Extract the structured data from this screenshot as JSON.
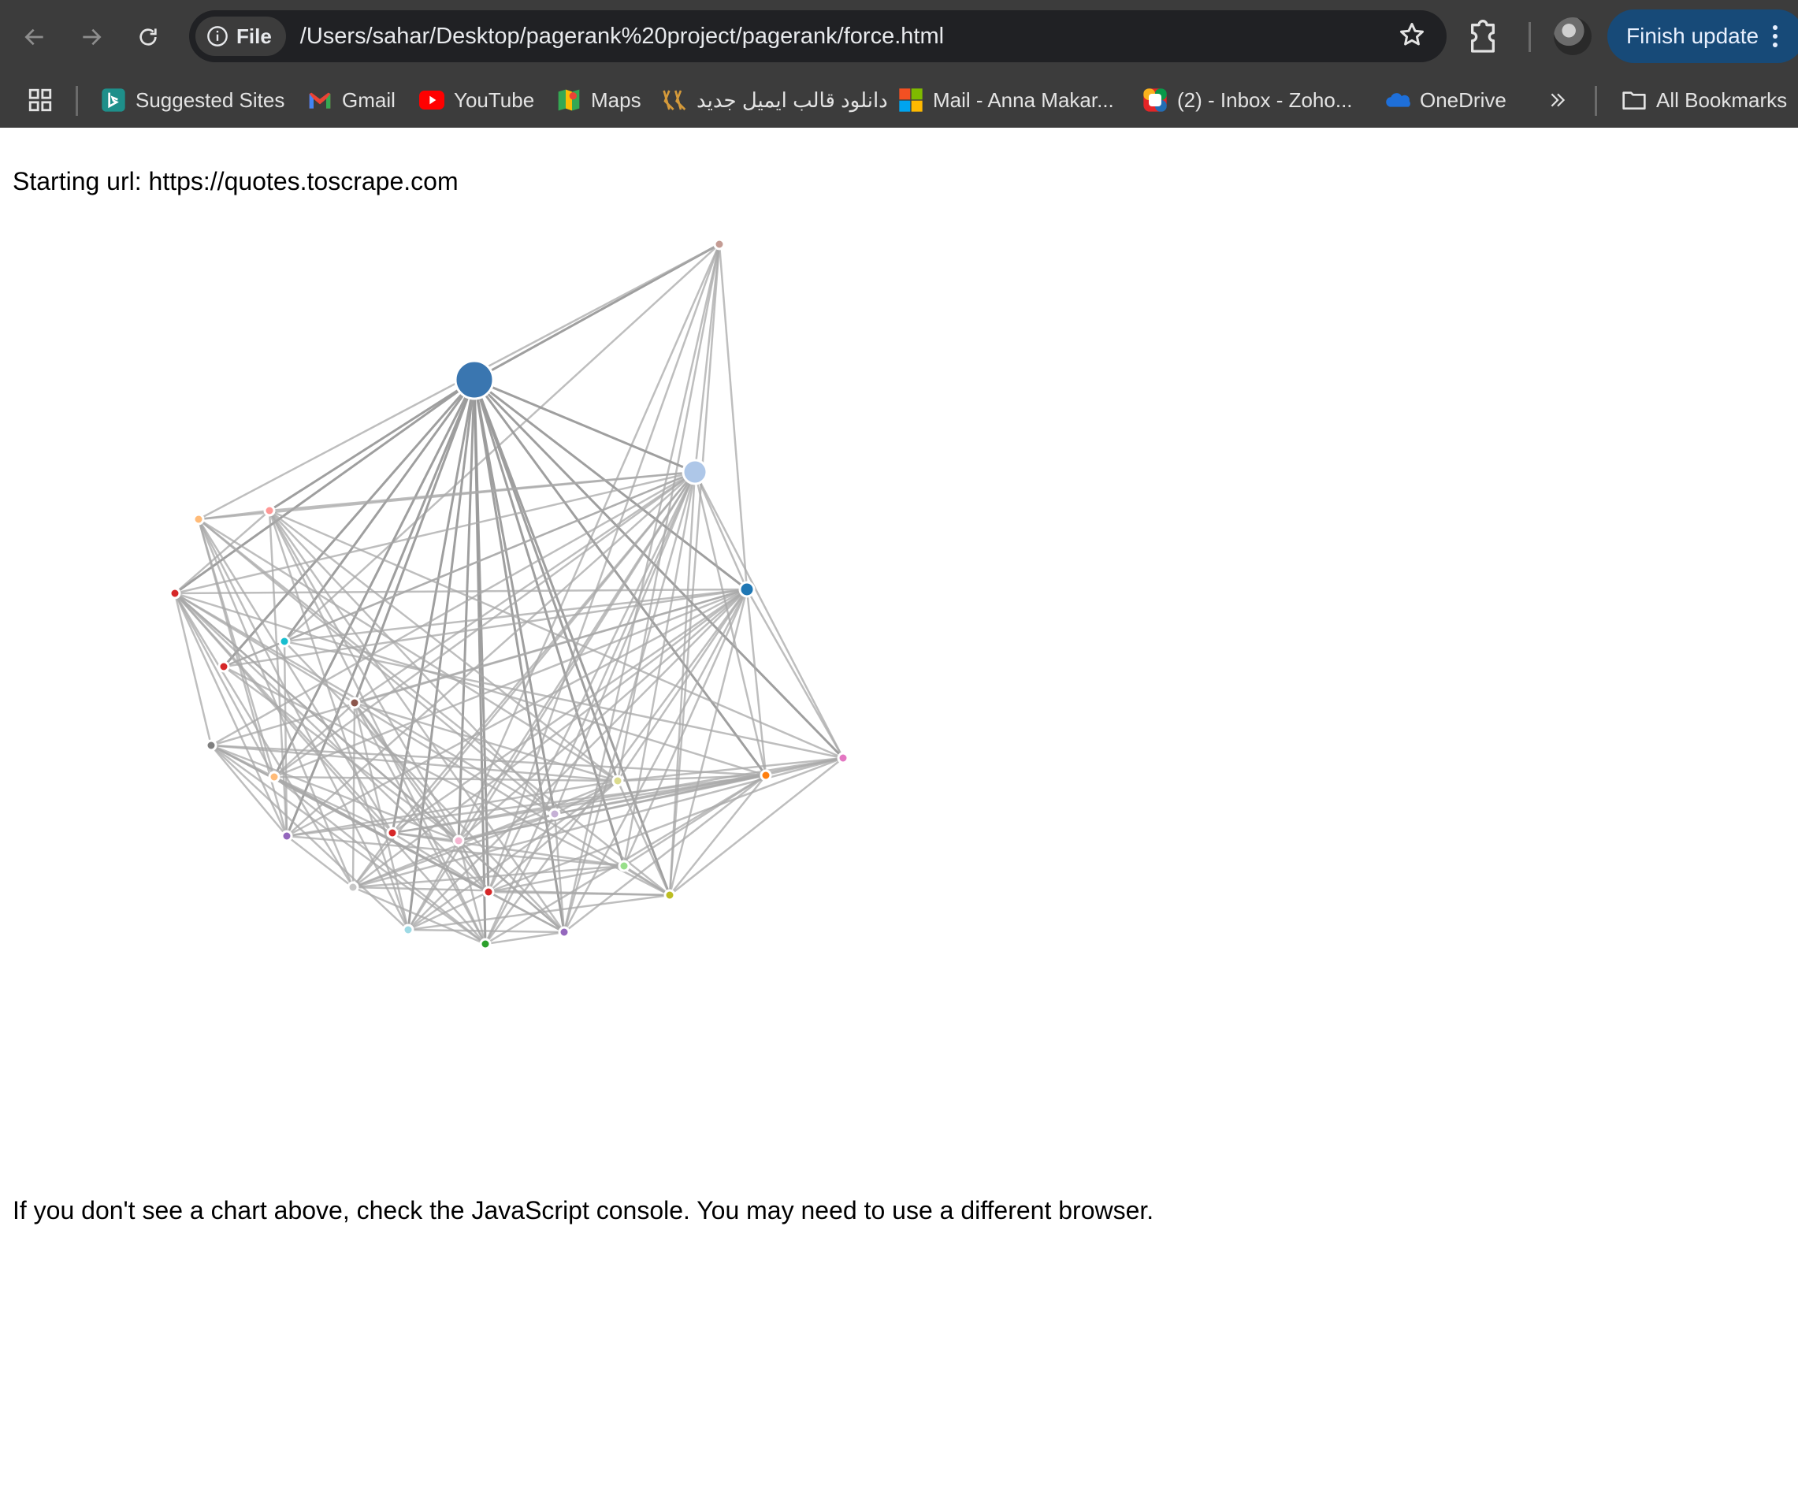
{
  "browser": {
    "site_chip_label": "File",
    "url": "/Users/sahar/Desktop/pagerank%20project/pagerank/force.html",
    "update_button_label": "Finish update",
    "icons": [
      "back-icon",
      "forward-icon",
      "reload-icon",
      "info-icon",
      "star-icon",
      "extensions-icon",
      "avatar",
      "kebab-menu-icon"
    ]
  },
  "bookmarks": [
    {
      "label": "Suggested Sites",
      "icon": "bing-icon"
    },
    {
      "label": "Gmail",
      "icon": "gmail-icon"
    },
    {
      "label": "YouTube",
      "icon": "youtube-icon"
    },
    {
      "label": "Maps",
      "icon": "maps-icon"
    },
    {
      "label": "دانلود قالب ایمیل جدید",
      "icon": "template-icon"
    },
    {
      "label": "Mail - Anna Makar...",
      "icon": "microsoft-icon"
    },
    {
      "label": "(2) - Inbox - Zoho...",
      "icon": "zoho-icon"
    },
    {
      "label": "OneDrive",
      "icon": "onedrive-icon"
    }
  ],
  "all_bookmarks_label": "All Bookmarks",
  "page": {
    "starting_url": "Starting url: https://quotes.toscrape.com",
    "footer_message": "If you don't see a chart above, check the JavaScript console. You may need to use a different browser."
  },
  "graph": {
    "type": "force-directed network",
    "node_count": 26,
    "node_colors": [
      "#c49c94",
      "#3a76b0",
      "#aec7e8",
      "#ffbb78",
      "#ff9896",
      "#d62728",
      "#1f77b4",
      "#17becf",
      "#d62728",
      "#8c564b",
      "#7f7f7f",
      "#e377c2",
      "#ff7f0e",
      "#ffbb78",
      "#dbdb8d",
      "#c5b0d5",
      "#9467bd",
      "#d62728",
      "#f7b6d2",
      "#98df8a",
      "#c7c7c7",
      "#d62728",
      "#bcbd22",
      "#9edae5",
      "#2ca02c",
      "#9467bd"
    ]
  }
}
